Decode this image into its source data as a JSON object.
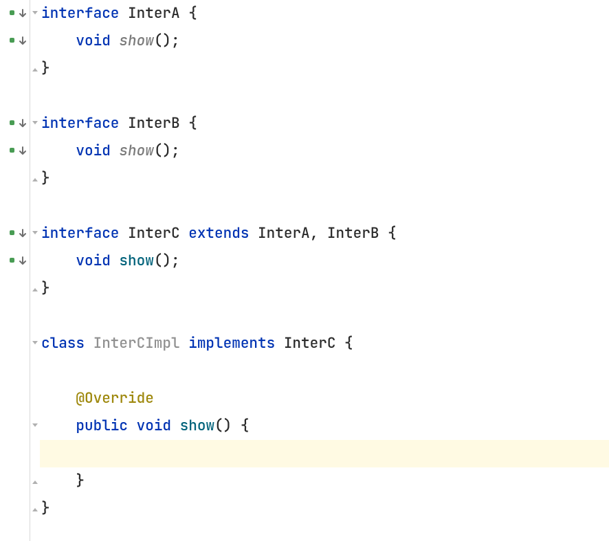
{
  "code": {
    "kw_interface": "interface",
    "kw_class": "class",
    "kw_void": "void",
    "kw_public": "public",
    "kw_extends": "extends",
    "kw_implements": "implements",
    "name_InterA": "InterA",
    "name_InterB": "InterB",
    "name_InterC": "InterC",
    "name_InterCImpl": "InterCImpl",
    "method_show": "show",
    "annotation_override": "@Override",
    "parens": "()",
    "lbrace": "{",
    "rbrace": "}",
    "semi": ";",
    "comma": ",",
    "space": " "
  },
  "gutter_icons": {
    "implemented": "implemented-down-icon",
    "fold_open": "fold-open-icon",
    "fold_close": "fold-close-icon"
  },
  "highlight_line_index": 16
}
